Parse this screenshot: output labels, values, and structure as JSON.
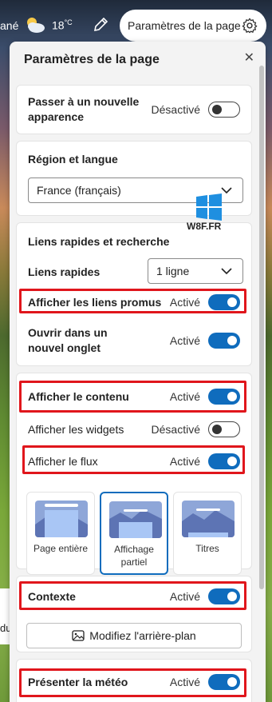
{
  "topbar": {
    "weather_partial": "ané",
    "temperature": "18",
    "temperature_unit": "°C",
    "page_settings_label": "Paramètres de la page"
  },
  "panel": {
    "title": "Paramètres de la page",
    "close_glyph": "✕"
  },
  "new_look": {
    "label": "Passer à un nouvelle apparence",
    "state": "Désactivé",
    "enabled": false
  },
  "region": {
    "heading": "Région et langue",
    "selected": "France (français)"
  },
  "quick_links": {
    "heading": "Liens rapides et recherche",
    "links_label": "Liens rapides",
    "links_value": "1 ligne",
    "promoted_label": "Afficher les liens promus",
    "promoted_state": "Activé",
    "new_tab_label": "Ouvrir dans un nouvel onglet",
    "new_tab_state": "Activé"
  },
  "content": {
    "show_content_label": "Afficher le contenu",
    "show_content_state": "Activé",
    "widgets_label": "Afficher les widgets",
    "widgets_state": "Désactivé",
    "feed_label": "Afficher le flux",
    "feed_state": "Activé",
    "layouts": [
      {
        "label": "Page entière"
      },
      {
        "label": "Affichage partiel"
      },
      {
        "label": "Titres"
      }
    ],
    "selected_layout": "Affichage partiel"
  },
  "context": {
    "label": "Contexte",
    "state": "Activé",
    "background_button": "Modifiez l'arrière-plan"
  },
  "weather": {
    "label": "Présenter la météo",
    "state": "Activé"
  },
  "watermark": {
    "text": "W8F.FR"
  },
  "left_strip_char": "du",
  "colors": {
    "accent": "#0f6cbd",
    "highlight": "#e0161c",
    "panel_bg": "#f3f3f3"
  }
}
